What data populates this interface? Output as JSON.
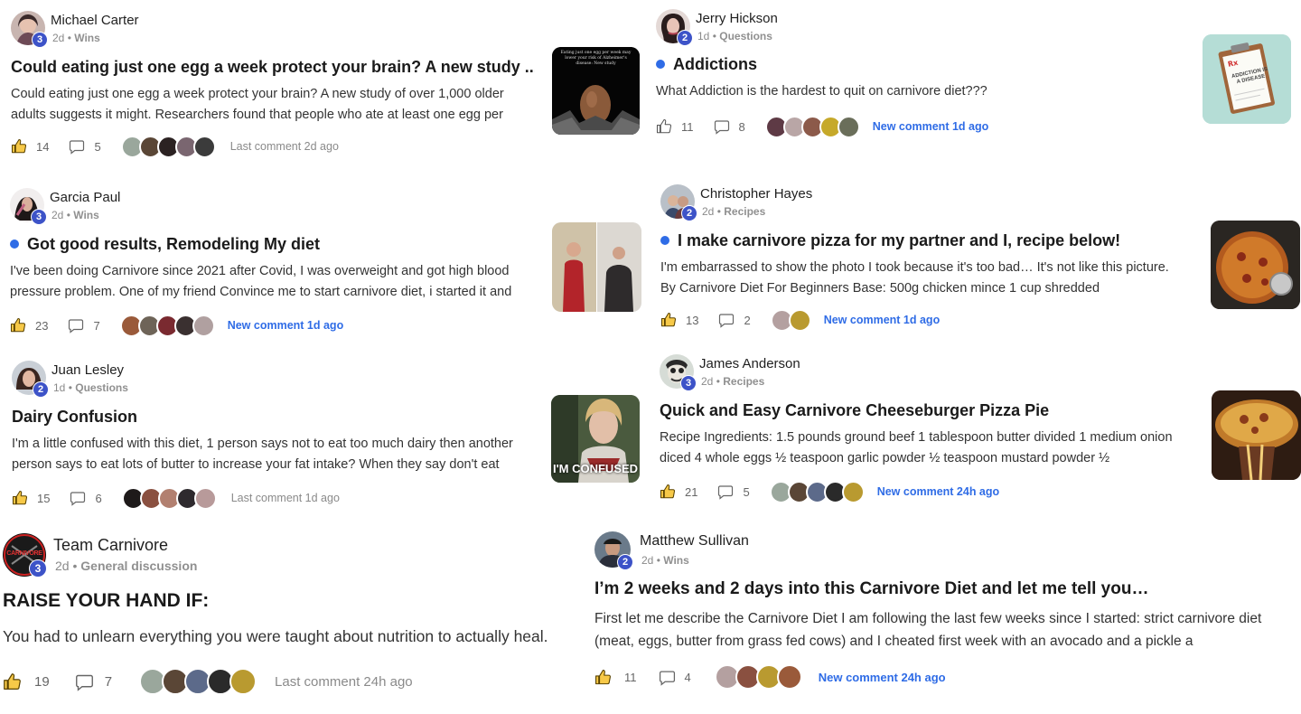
{
  "posts": [
    {
      "author": "Michael Carter",
      "level": "3",
      "time": "2d",
      "category": "Wins",
      "title": "Could eating just one egg a week protect your brain? A new study ...",
      "body": "Could eating just one egg a week protect your brain? A new study of over 1,000 older adults suggests it might. Researchers found that people who ate at least one egg per",
      "likes": "14",
      "comments": "5",
      "activity": "Last comment 2d ago",
      "activity_new": false,
      "unread": false,
      "thumb_text": "Eating just one egg per week may lower your risk of Alzheimer's disease: New study"
    },
    {
      "author": "Jerry Hickson",
      "level": "2",
      "time": "1d",
      "category": "Questions",
      "title": "Addictions",
      "body": "What Addiction is the hardest to quit on carnivore diet???",
      "likes": "11",
      "comments": "8",
      "activity": "New comment 1d ago",
      "activity_new": true,
      "unread": true,
      "thumb_text": "ADDICTION IS A DISEASE"
    },
    {
      "author": "Garcia Paul",
      "level": "3",
      "time": "2d",
      "category": "Wins",
      "title": "Got good results, Remodeling My diet",
      "body": "I've been doing Carnivore since 2021 after Covid, I was overweight and got high blood pressure problem. One of my friend Convince me to start carnivore diet, i started it and",
      "likes": "23",
      "comments": "7",
      "activity": "New comment 1d ago",
      "activity_new": true,
      "unread": true
    },
    {
      "author": "Christopher Hayes",
      "level": "2",
      "time": "2d",
      "category": "Recipes",
      "title": "I make carnivore pizza for my partner and I, recipe below!",
      "body": "I'm embarrassed to show the photo I took because it's too bad… It's not like this picture. By Carnivore Diet For Beginners Base: 500g chicken mince 1 cup shredded",
      "likes": "13",
      "comments": "2",
      "activity": "New comment 1d ago",
      "activity_new": true,
      "unread": true
    },
    {
      "author": "Juan Lesley",
      "level": "2",
      "time": "1d",
      "category": "Questions",
      "title": "Dairy Confusion",
      "body": "I'm a little confused with this diet, 1 person says not to eat too much dairy then another person says to eat lots of butter to increase your fat intake? When they say don't eat",
      "likes": "15",
      "comments": "6",
      "activity": "Last comment 1d ago",
      "activity_new": false,
      "unread": false,
      "thumb_text": "I'M CONFUSED"
    },
    {
      "author": "James Anderson",
      "level": "3",
      "time": "2d",
      "category": "Recipes",
      "title": "Quick and Easy Carnivore Cheeseburger Pizza Pie",
      "body": "Recipe Ingredients: 1.5 pounds ground beef 1 tablespoon butter divided 1 medium onion diced 4 whole eggs ½ teaspoon garlic powder ½ teaspoon mustard powder ½",
      "likes": "21",
      "comments": "5",
      "activity": "New comment 24h ago",
      "activity_new": true,
      "unread": false
    },
    {
      "author": "Team Carnivore",
      "level": "3",
      "time": "2d",
      "category": "General discussion",
      "title": "RAISE YOUR HAND IF:",
      "body": "You had to unlearn everything you were taught about nutrition to actually heal.",
      "likes": "19",
      "comments": "7",
      "activity": "Last comment 24h ago",
      "activity_new": false,
      "unread": false,
      "logo_text": "CARNIVORE"
    },
    {
      "author": "Matthew Sullivan",
      "level": "2",
      "time": "2d",
      "category": "Wins",
      "title": "I’m 2 weeks and 2 days into this Carnivore Diet and let me tell you…",
      "body": "First let me describe the Carnivore Diet I am following the last few weeks since I started: strict carnivore diet (meat, eggs, butter from grass fed cows) and I cheated first week with an avocado and a pickle a",
      "likes": "11",
      "comments": "4",
      "activity": "New comment 24h ago",
      "activity_new": true,
      "unread": false
    }
  ],
  "colors": {
    "accent": "#2f6ce6",
    "level_badge": "#3d53c8",
    "muted": "#8a8a8a"
  },
  "icons": {
    "like": "thumbs-up-icon",
    "comment": "comment-bubble-icon",
    "unread": "unread-dot-icon"
  }
}
